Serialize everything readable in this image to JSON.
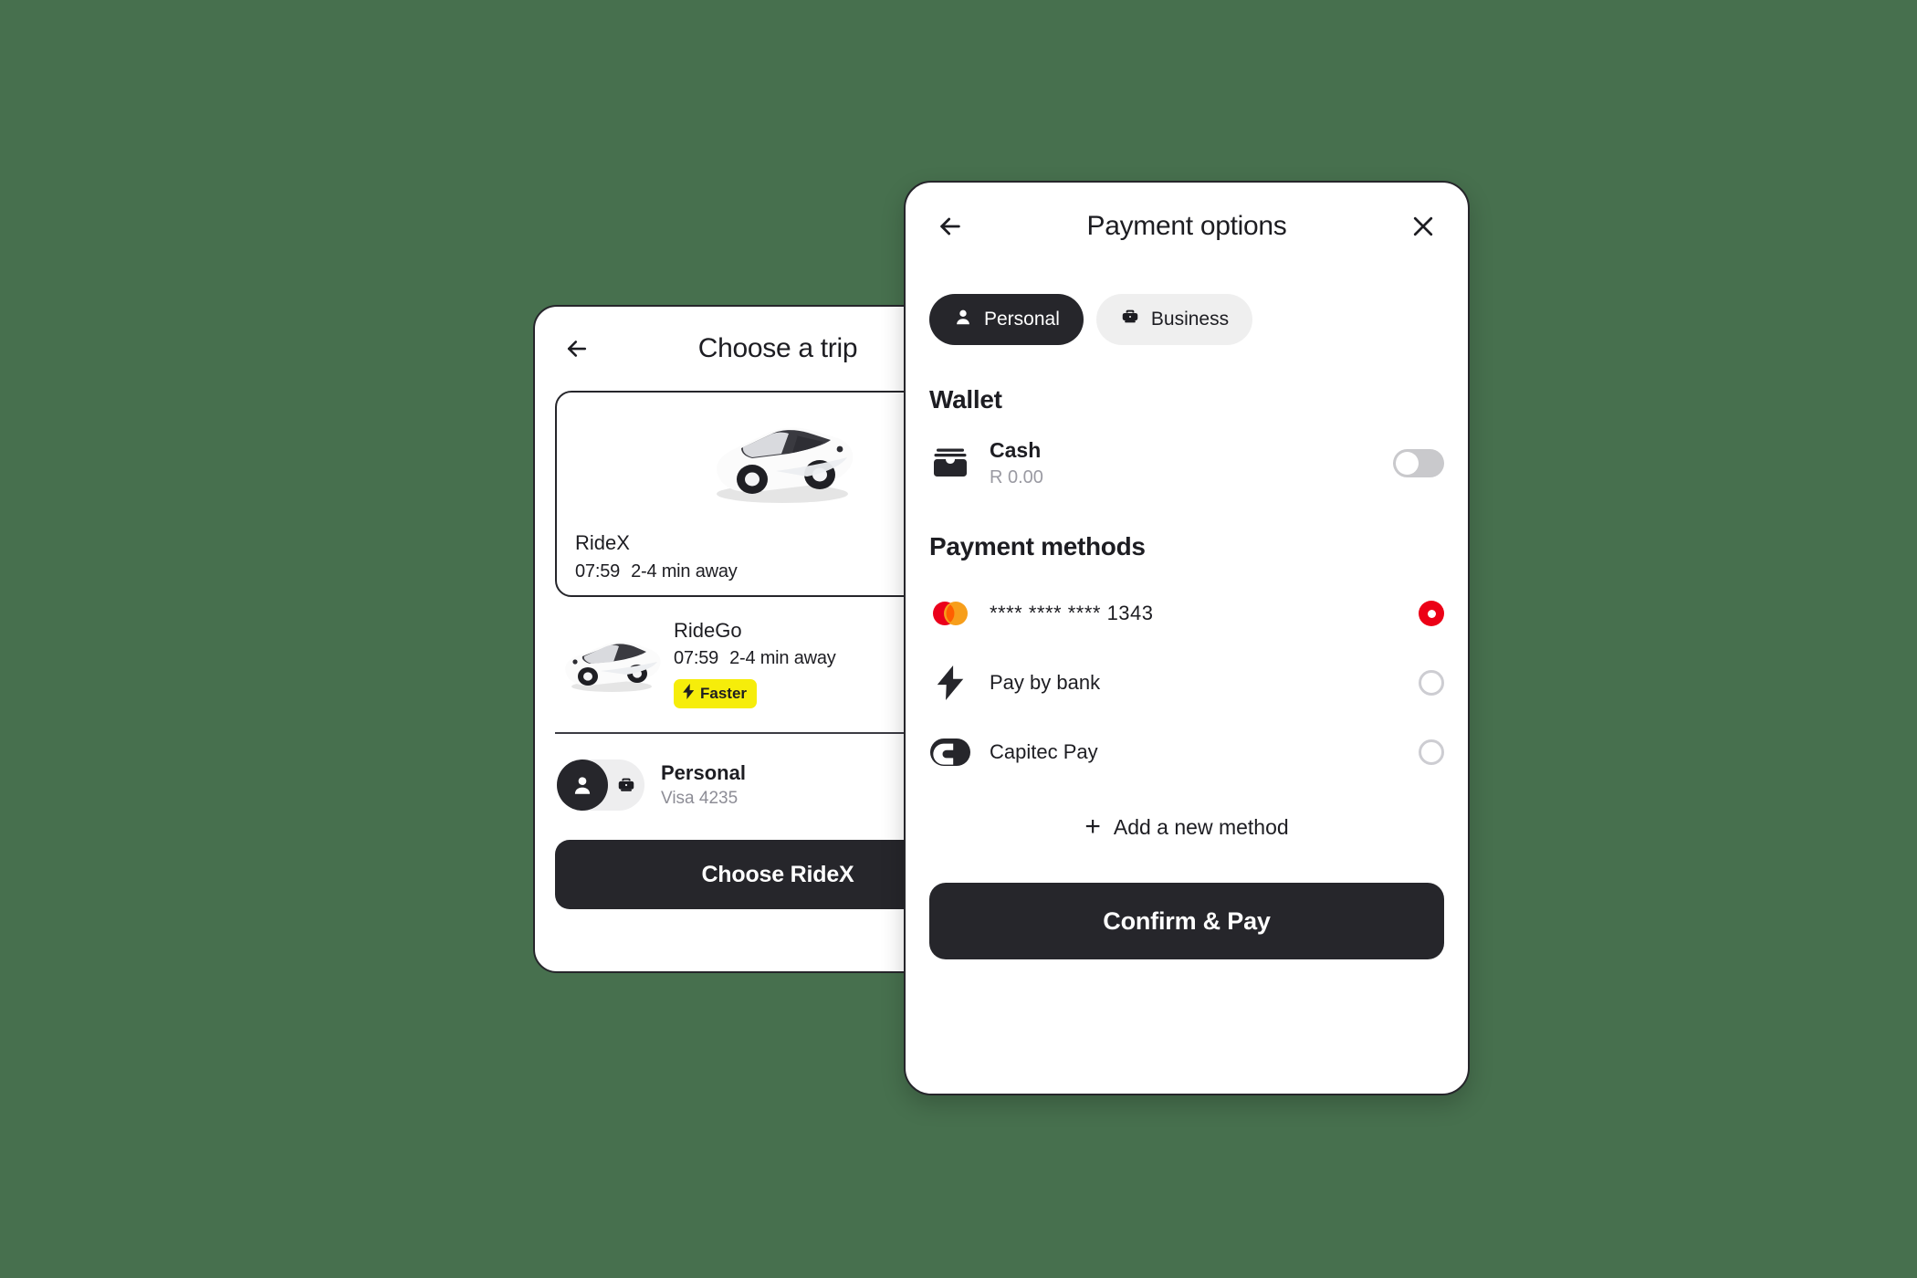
{
  "background_color": "#47704e",
  "trip_screen": {
    "title": "Choose a trip",
    "back_icon": "arrow-left-icon",
    "rides": [
      {
        "name": "RideX",
        "time": "07:59",
        "eta": "2-4 min away",
        "selected": true,
        "badge": null
      },
      {
        "name": "RideGo",
        "time": "07:59",
        "eta": "2-4 min away",
        "selected": false,
        "badge": "Faster",
        "badge_icon": "bolt-icon",
        "badge_color": "#f6ed0a"
      }
    ],
    "account": {
      "title": "Personal",
      "subtitle": "Visa 4235",
      "person_icon": "person-icon",
      "business_icon": "briefcase-icon"
    },
    "cta_label": "Choose RideX"
  },
  "payment_screen": {
    "title": "Payment options",
    "back_icon": "arrow-left-icon",
    "close_icon": "close-icon",
    "segments": [
      {
        "label": "Personal",
        "icon": "person-icon",
        "active": true
      },
      {
        "label": "Business",
        "icon": "briefcase-icon",
        "active": false
      }
    ],
    "wallet": {
      "heading": "Wallet",
      "item": {
        "name": "Cash",
        "balance": "R 0.00",
        "icon": "cash-wallet-icon",
        "toggle_on": false
      }
    },
    "methods": {
      "heading": "Payment methods",
      "items": [
        {
          "label": "**** **** **** 1343",
          "icon": "mastercard-icon",
          "selected": true
        },
        {
          "label": "Pay by bank",
          "icon": "bolt-icon",
          "selected": false
        },
        {
          "label": "Capitec Pay",
          "icon": "capitec-icon",
          "selected": false
        }
      ],
      "add_label": "Add a new method",
      "add_icon": "plus-icon"
    },
    "cta_label": "Confirm & Pay",
    "accent_selected_color": "#ec0016",
    "mastercard_red": "#eb001b",
    "mastercard_orange": "#f79e1b"
  }
}
